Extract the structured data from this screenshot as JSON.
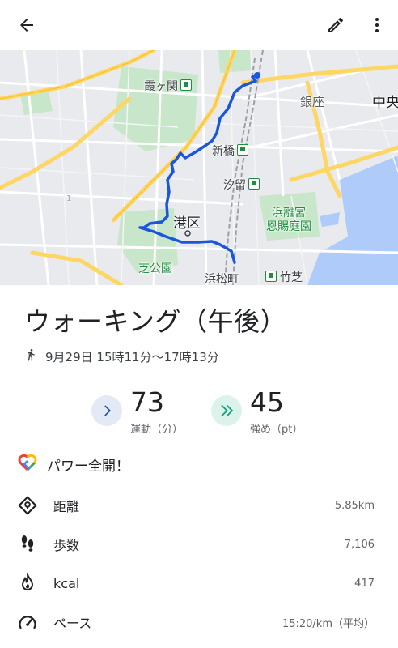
{
  "appbar": {
    "back_icon": "arrow-back-icon",
    "edit_icon": "pencil-icon",
    "more_icon": "more-vert-icon"
  },
  "map": {
    "labels": {
      "kasumigaseki": "霞ヶ関",
      "ginza": "銀座",
      "chuo": "中央",
      "shinbashi": "新橋",
      "shiodome": "汐留",
      "hamarikyu": "浜離宮",
      "onshi_teien": "恩賜庭園",
      "minato_ku": "港区",
      "shiba_koen": "芝公園",
      "hamamatsucho": "浜松町",
      "takeshiba": "竹芝",
      "route_marker": "1"
    },
    "route_color": "#1a56db"
  },
  "activity": {
    "title": "ウォーキング（午後）",
    "datetime": "9月29日 15時11分～17時13分",
    "activity_icon": "walking-icon"
  },
  "stats": {
    "move_minutes": {
      "value": "73",
      "label": "運動（分）",
      "icon": "chevron-right-icon",
      "color": "#1a4ea3"
    },
    "heart_points": {
      "value": "45",
      "label": "強め（pt）",
      "icon": "double-chevron-icon",
      "color": "#12a37a"
    }
  },
  "power": {
    "label": "パワー全開！",
    "icon": "google-fit-heart-icon"
  },
  "metrics": [
    {
      "name": "距離",
      "value": "5.85km",
      "icon": "location-diamond-icon"
    },
    {
      "name": "歩数",
      "value": "7,106",
      "icon": "footsteps-icon"
    },
    {
      "name": "kcal",
      "value": "417",
      "icon": "flame-icon"
    },
    {
      "name": "ペース",
      "value": "15:20/km（平均）",
      "icon": "speedometer-icon"
    }
  ]
}
